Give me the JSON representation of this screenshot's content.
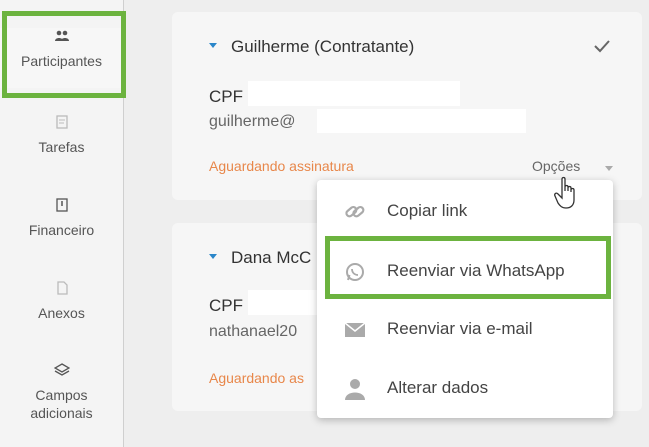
{
  "sidebar": {
    "items": [
      {
        "label": "Participantes",
        "icon": "participants-icon",
        "active": true
      },
      {
        "label": "Tarefas",
        "icon": "tasks-icon"
      },
      {
        "label": "Financeiro",
        "icon": "finance-icon"
      },
      {
        "label": "Anexos",
        "icon": "attachment-icon"
      },
      {
        "label_line1": "Campos",
        "label_line2": "adicionais",
        "icon": "layers-icon"
      }
    ]
  },
  "participants": [
    {
      "name": "Guilherme (Contratante)",
      "cpf_label": "CPF",
      "email_prefix": "guilherme@",
      "status": "Aguardando assinatura",
      "options_label": "Opções"
    },
    {
      "name": "Dana McC",
      "cpf_label": "CPF",
      "email_prefix": "nathanael20",
      "status": "Aguardando as"
    }
  ],
  "dropdown": {
    "items": [
      {
        "label": "Copiar link",
        "icon": "link-icon"
      },
      {
        "label": "Reenviar via WhatsApp",
        "icon": "whatsapp-icon"
      },
      {
        "label": "Reenviar via e-mail",
        "icon": "mail-icon"
      },
      {
        "label": "Alterar dados",
        "icon": "user-icon"
      }
    ]
  },
  "colors": {
    "highlight": "#6cb33f",
    "status": "#e8874a",
    "accent": "#2b86c9"
  }
}
